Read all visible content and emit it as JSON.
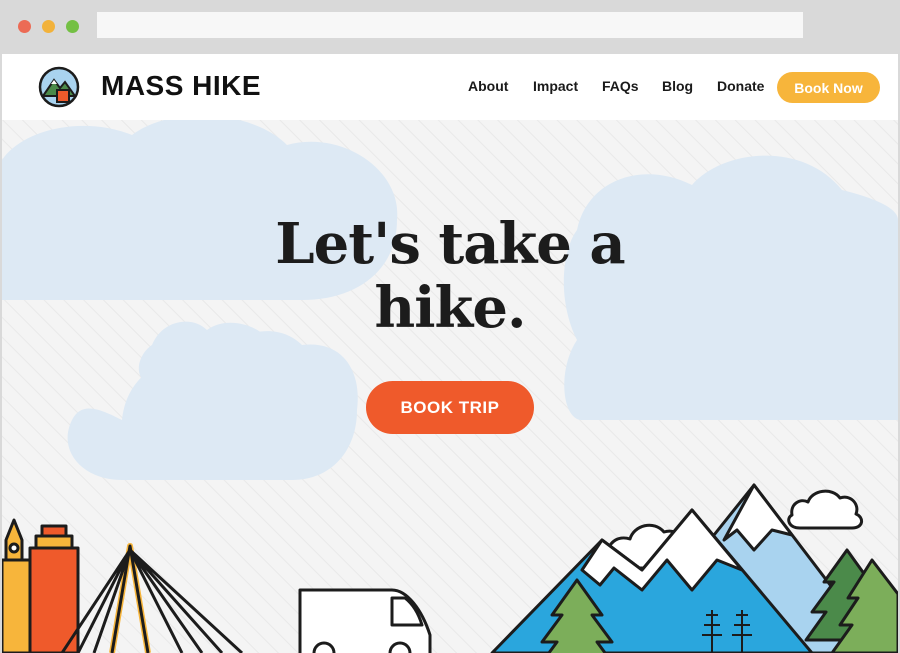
{
  "brand": {
    "name": "MASS HIKE",
    "logo_icon": "mountain-logo-icon"
  },
  "nav": {
    "links": [
      {
        "label": "About"
      },
      {
        "label": "Impact"
      },
      {
        "label": "FAQs"
      },
      {
        "label": "Blog"
      },
      {
        "label": "Donate"
      }
    ],
    "cta_label": "Book Now"
  },
  "hero": {
    "headline_line1": "Let's take a",
    "headline_line2": "hike.",
    "cta_label": "BOOK TRIP"
  },
  "colors": {
    "accent_orange": "#ef5a2b",
    "accent_yellow": "#f7b53b",
    "sky_cloud": "#dde9f4",
    "mountain_blue": "#2aa6dd"
  }
}
